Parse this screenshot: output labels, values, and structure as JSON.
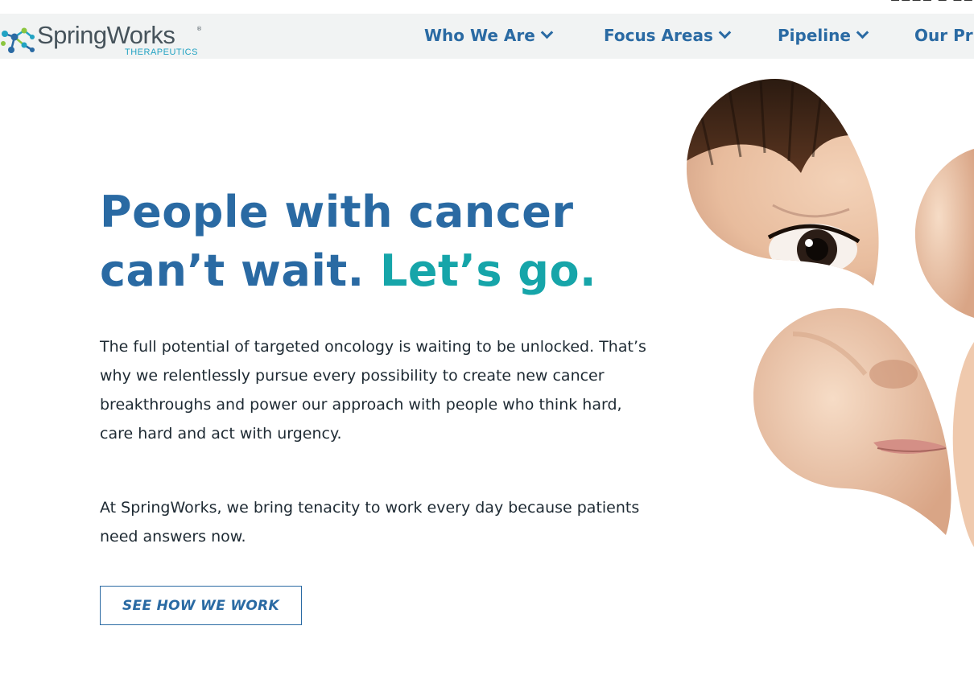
{
  "brand": {
    "name": "SpringWorks",
    "registered": "®",
    "tagline": "THERAPEUTICS",
    "colors": {
      "primary": "#2a6aa3",
      "accent": "#16a5a9",
      "logo_text": "#46535b",
      "logo_sub": "#22a3c3",
      "nav_bg": "#f1f3f3"
    }
  },
  "nav": {
    "items": [
      {
        "label": "Who We Are",
        "icon": "chevron-down-icon"
      },
      {
        "label": "Focus Areas",
        "icon": "chevron-down-icon"
      },
      {
        "label": "Pipeline",
        "icon": "chevron-down-icon"
      },
      {
        "label": "Our Pr"
      }
    ]
  },
  "hero": {
    "title_line1": "People with cancer",
    "title_line2_main": "can’t wait. ",
    "title_line2_accent": "Let’s go.",
    "paragraph1": "The full potential of targeted oncology is waiting to be unlocked. That’s why we relentlessly pursue every possibility to create new cancer breakthroughs and power our approach with people who think hard, care hard and act with urgency.",
    "paragraph2": "At SpringWorks, we bring tenacity to work every day because patients need answers now.",
    "cta_label": "SEE HOW WE WORK"
  },
  "image": {
    "subject": "child-face-petal-photo"
  }
}
